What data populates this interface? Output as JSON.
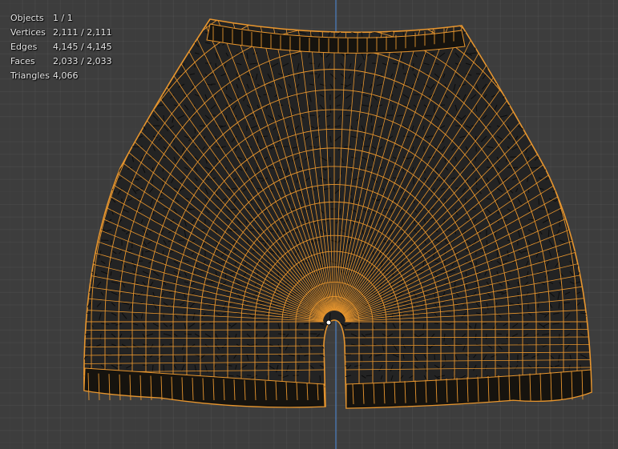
{
  "stats": [
    {
      "label": "Objects",
      "value": "1 / 1"
    },
    {
      "label": "Vertices",
      "value": "2,111 / 2,111"
    },
    {
      "label": "Edges",
      "value": "4,145 / 4,145"
    },
    {
      "label": "Faces",
      "value": "2,033 / 2,033"
    },
    {
      "label": "Triangles",
      "value": "4,066"
    }
  ],
  "colors": {
    "background": "#3d3d3d",
    "wire_selected": "#e8962e",
    "mesh_fill": "#232323",
    "waistband": "#16130e",
    "axis_line": "#4a7fc1"
  },
  "icons": {
    "origin": "object-origin-icon"
  }
}
